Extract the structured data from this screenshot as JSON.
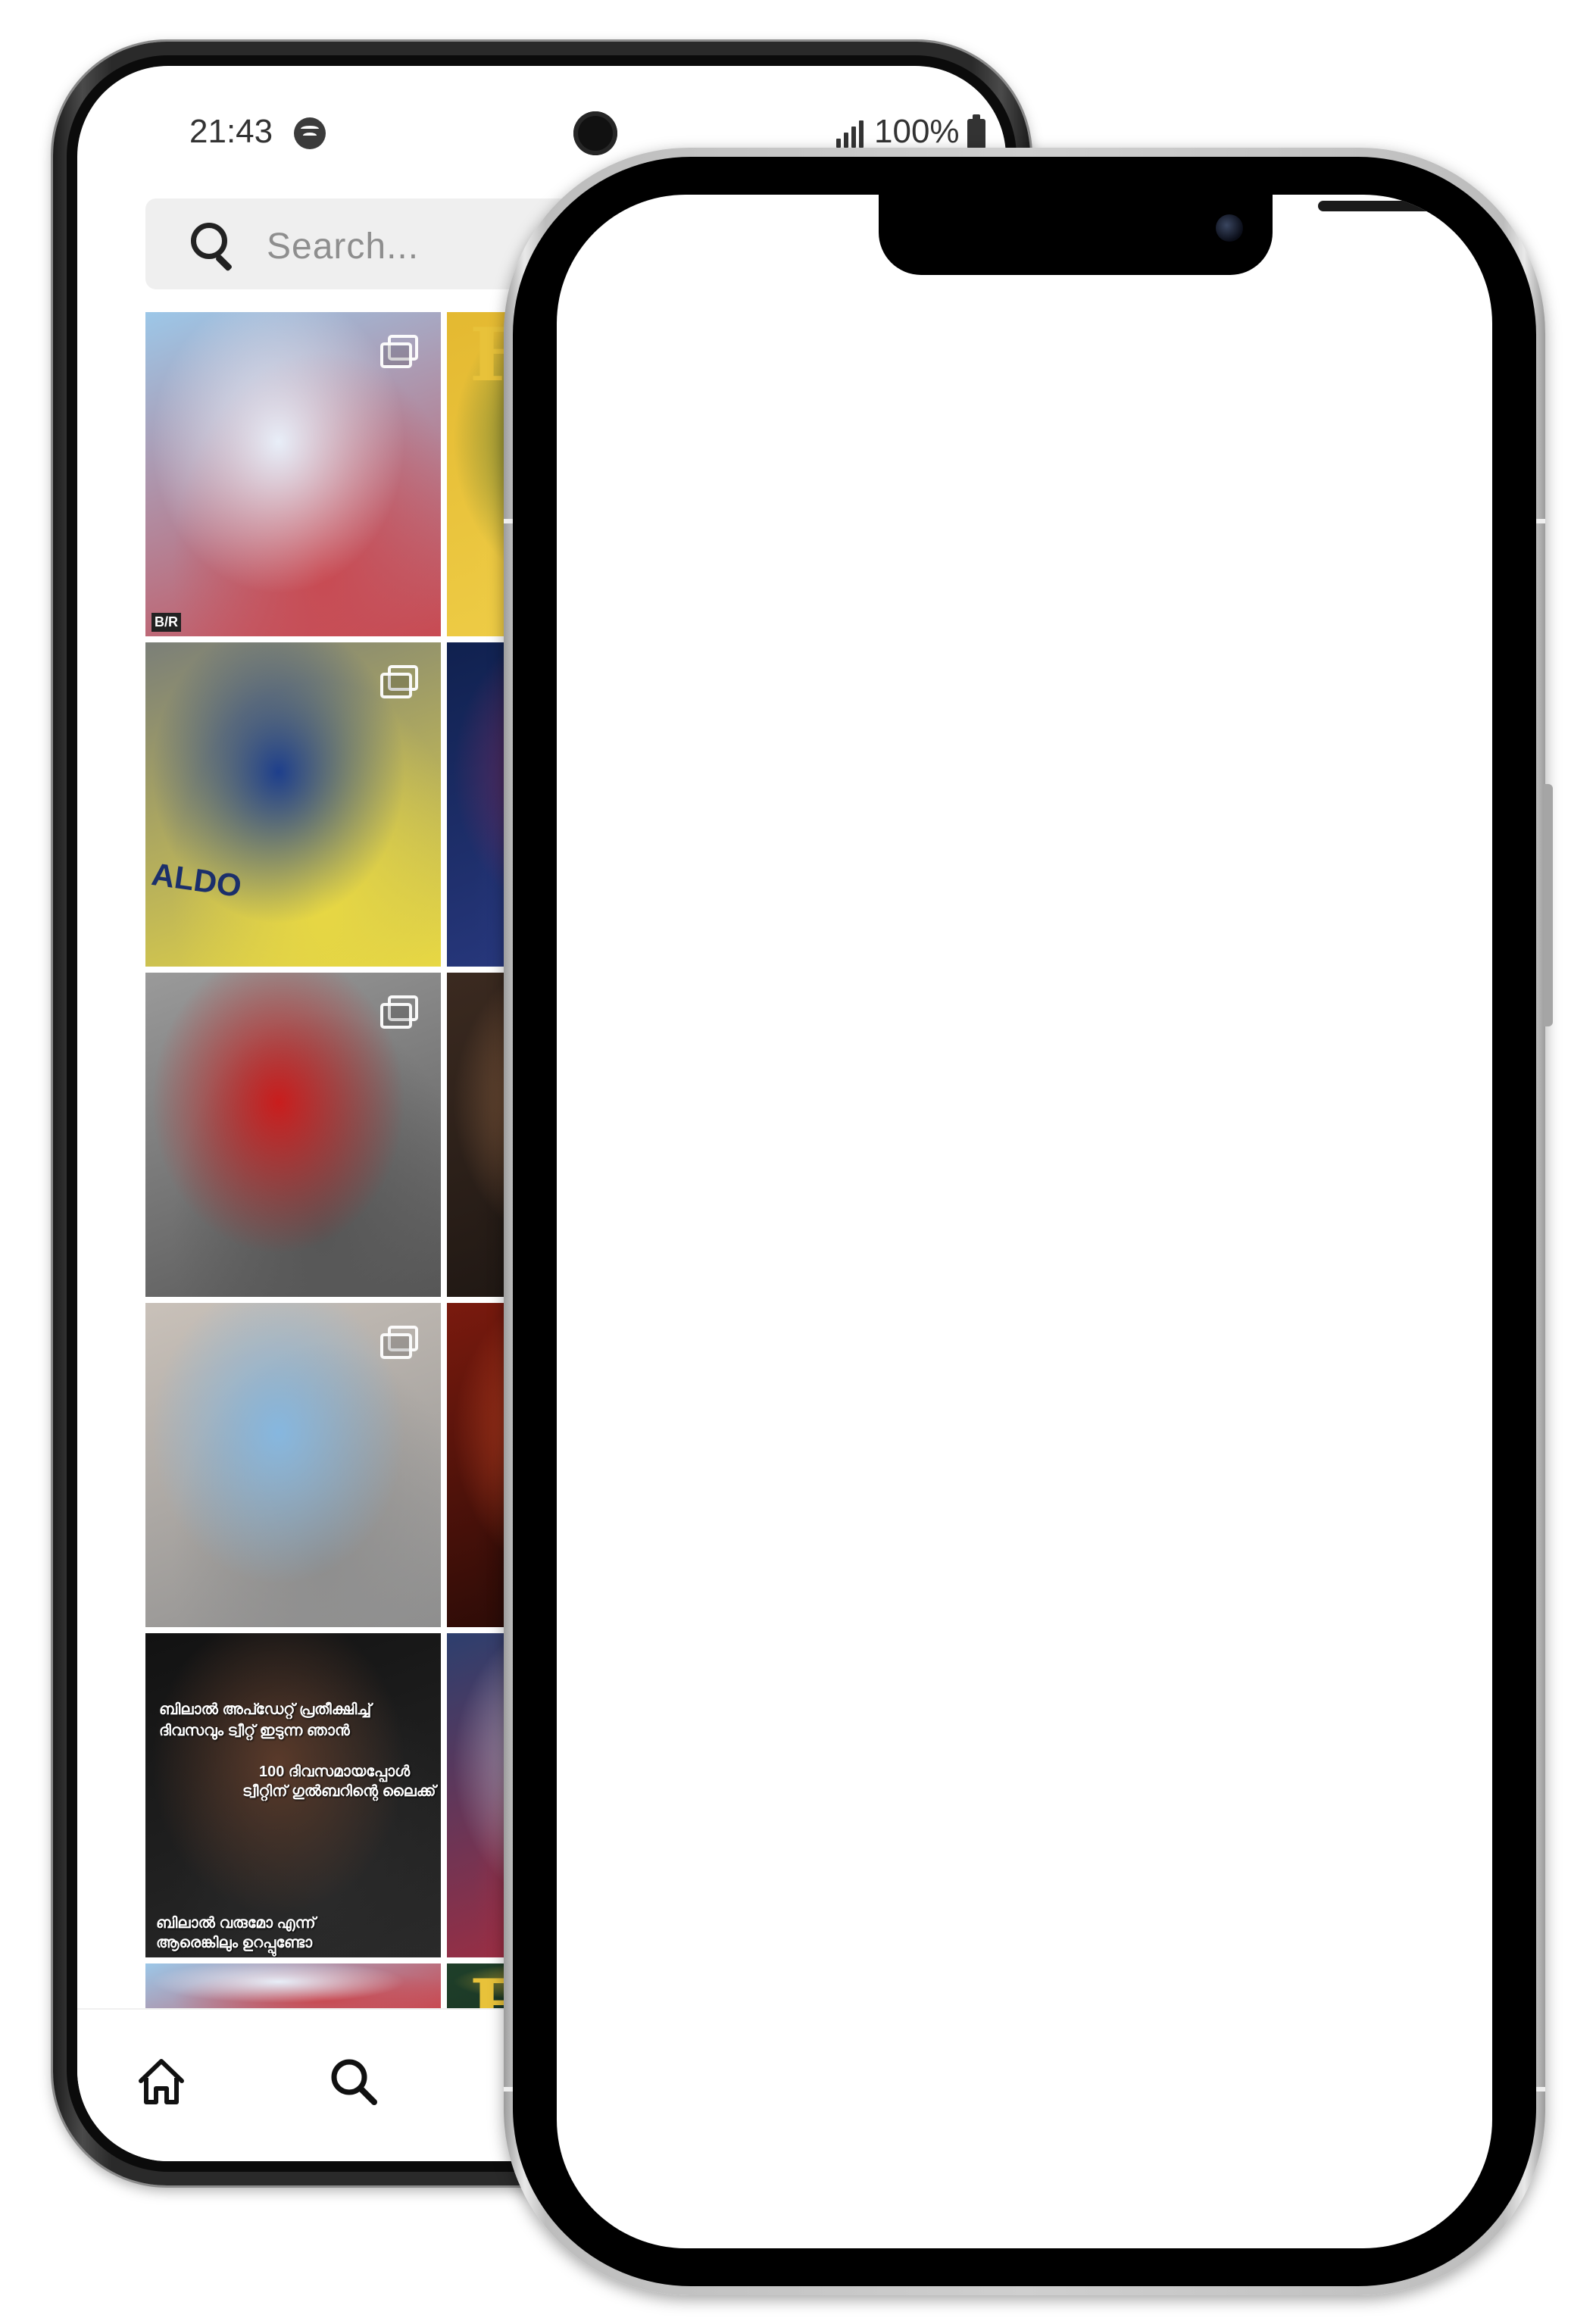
{
  "status_bar": {
    "time": "21:43",
    "battery": "100%"
  },
  "search": {
    "placeholder": "Search..."
  },
  "tiles": [
    {
      "id": "tile-team-photo",
      "colors": [
        "#9cc7e8",
        "#e8eef8",
        "#c84a52"
      ],
      "multi": true,
      "watermark": "B/R"
    },
    {
      "id": "tile-magazine-cover",
      "colors": [
        "#e4b931",
        "#2e5a2d",
        "#f0d04a"
      ],
      "multi": false,
      "text": "Ful"
    },
    {
      "id": "tile-ronaldo",
      "colors": [
        "#7b7f78",
        "#1e3f8c",
        "#e8d843"
      ],
      "multi": true,
      "text": "ALDO"
    },
    {
      "id": "tile-clasico-poster",
      "colors": [
        "#10214f",
        "#8a2a5b",
        "#2c3c86"
      ],
      "multi": false
    },
    {
      "id": "tile-motogp",
      "colors": [
        "#9a9a9a",
        "#c91d1d",
        "#565656"
      ],
      "multi": true
    },
    {
      "id": "tile-dark-scene",
      "colors": [
        "#3b2a20",
        "#a9744d",
        "#1a1411"
      ],
      "multi": false
    },
    {
      "id": "tile-couple",
      "colors": [
        "#c9c1b9",
        "#86b7df",
        "#8e8e8e"
      ],
      "multi": true
    },
    {
      "id": "tile-red-portrait",
      "colors": [
        "#7a1a0e",
        "#e0522a",
        "#1a0805"
      ],
      "multi": false
    },
    {
      "id": "tile-meme",
      "colors": [
        "#121212",
        "#5a3a2a",
        "#2a2a2a"
      ],
      "multi": false,
      "captions": [
        "ബിലാൽ അപ്ഡേറ്റ് പ്രതീക്ഷിച്ച്",
        "ദിവസവും ട്വീറ്റ് ഇടുന്ന ഞാൻ",
        "100 ദിവസമായപ്പോൾ",
        "ട്വീറ്റിന് ഗുൽബറിന്റെ ലൈക്ക്",
        "ബിലാൽ വരുമോ എന്ന്",
        "ആരെങ്കിലും ഉറപ്പുണ്ടോ"
      ]
    },
    {
      "id": "tile-psg-player",
      "colors": [
        "#2d3f6e",
        "#d8d8e6",
        "#b22a3a"
      ],
      "multi": false
    },
    {
      "id": "tile-team-photo-repeat",
      "colors": [
        "#9cc7e8",
        "#e8eef8",
        "#c84a52"
      ],
      "multi": false
    },
    {
      "id": "tile-magazine-repeat",
      "colors": [
        "#1f3f2a",
        "#e4b931",
        "#173020"
      ],
      "multi": false,
      "text": "Ful"
    }
  ],
  "bottom_nav": {
    "items": [
      {
        "name": "home",
        "icon": "home-icon"
      },
      {
        "name": "search",
        "icon": "search-icon"
      }
    ]
  }
}
